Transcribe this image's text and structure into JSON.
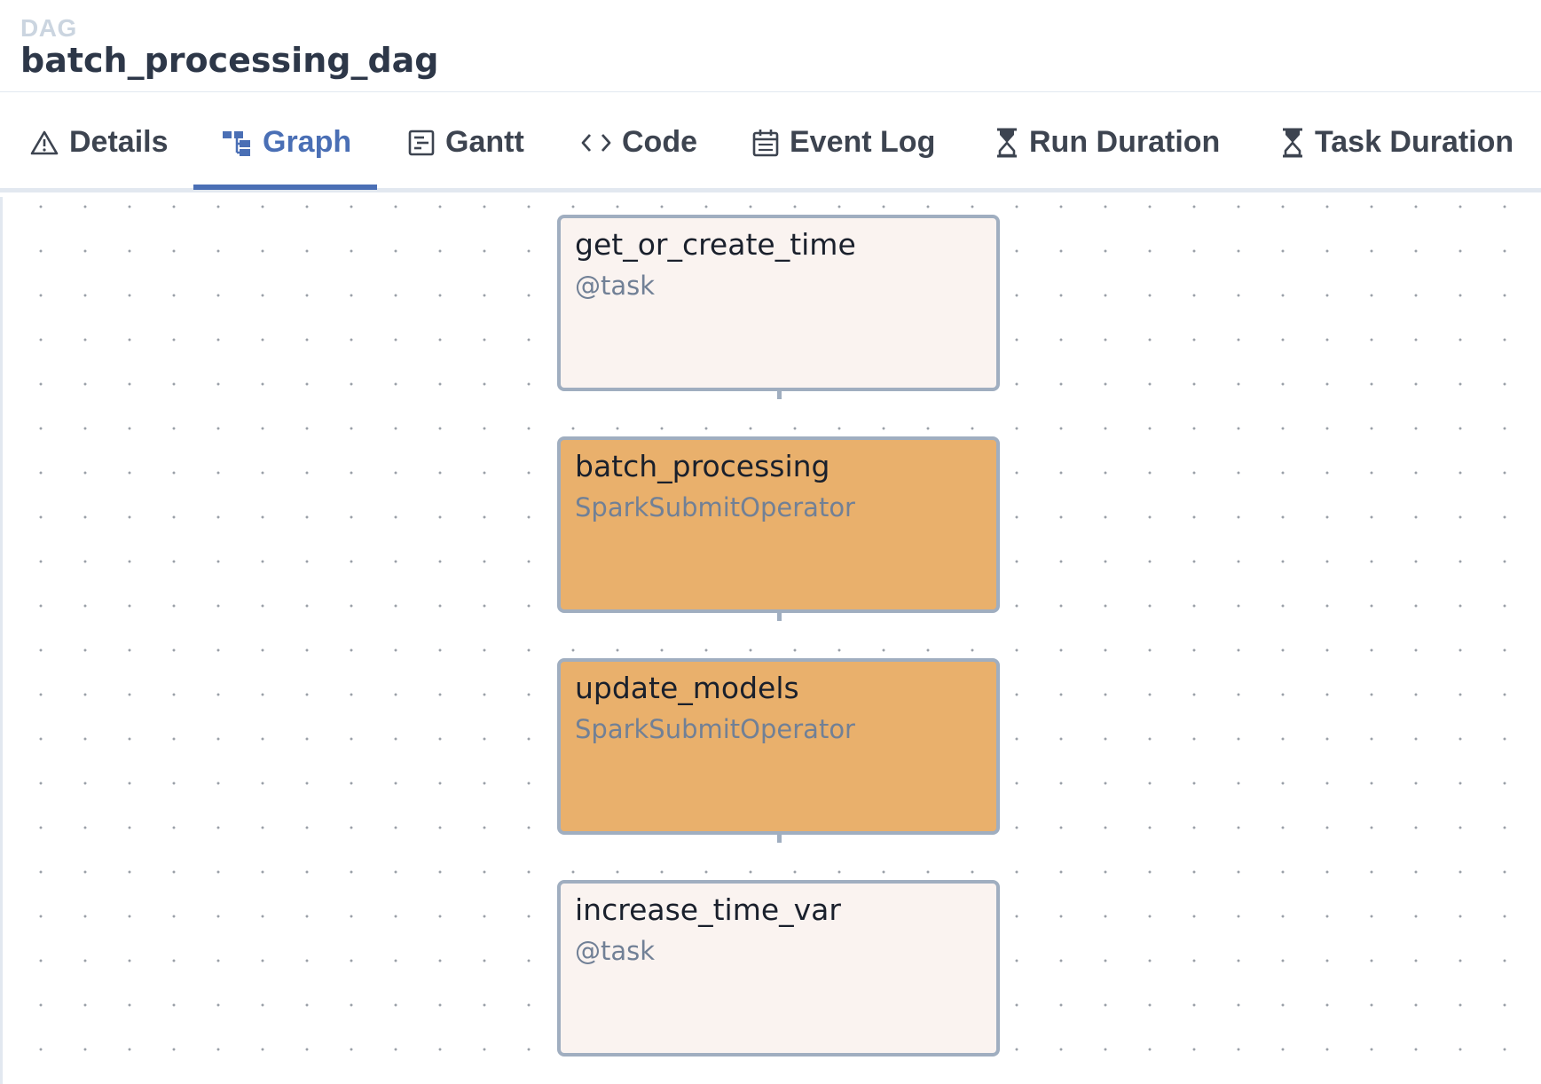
{
  "header": {
    "label": "DAG",
    "dag_id": "batch_processing_dag"
  },
  "tabs": [
    {
      "label": "Details",
      "icon": "warning-triangle-icon",
      "active": false
    },
    {
      "label": "Graph",
      "icon": "graph-icon",
      "active": true
    },
    {
      "label": "Gantt",
      "icon": "gantt-icon",
      "active": false
    },
    {
      "label": "Code",
      "icon": "code-icon",
      "active": false
    },
    {
      "label": "Event Log",
      "icon": "calendar-icon",
      "active": false
    },
    {
      "label": "Run Duration",
      "icon": "hourglass-icon",
      "active": false
    },
    {
      "label": "Task Duration",
      "icon": "hourglass-icon",
      "active": false
    }
  ],
  "graph": {
    "nodes": [
      {
        "name": "get_or_create_time",
        "operator": "@task",
        "state_color": "#faf3f0"
      },
      {
        "name": "batch_processing",
        "operator": "SparkSubmitOperator",
        "state_color": "#e9b06c"
      },
      {
        "name": "update_models",
        "operator": "SparkSubmitOperator",
        "state_color": "#e9b06c"
      },
      {
        "name": "increase_time_var",
        "operator": "@task",
        "state_color": "#faf3f0"
      }
    ]
  },
  "colors": {
    "accent": "#4a6fb5",
    "edge": "#a0aec0",
    "queued_node": "#e9b06c",
    "default_node": "#faf3f0"
  }
}
